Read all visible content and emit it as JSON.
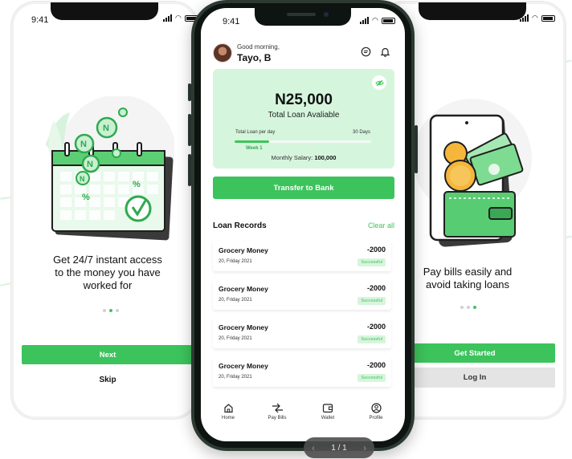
{
  "accent": "#3cc35c",
  "left_screen": {
    "time": "9:41",
    "onboarding_text": "Get 24/7 instant access to the money you have worked for",
    "next_label": "Next",
    "skip_label": "Skip",
    "active_dot": 2
  },
  "right_screen": {
    "onboarding_text": "Pay bills easily and avoid taking loans",
    "get_started_label": "Get Started",
    "login_label": "Log In",
    "active_dot": 3
  },
  "center_screen": {
    "time": "9:41",
    "greeting": "Good morning,",
    "username": "Tayo, B",
    "balance": {
      "amount": "N25,000",
      "label": "Total Loan Avaliable",
      "period_left": "Total Loan per day",
      "period_right": "30 Days",
      "progress": 0.25,
      "week_label": "Week 1",
      "salary_label": "Monthly Salary:",
      "salary_value": "100,000"
    },
    "transfer_label": "Transfer to Bank",
    "records_title": "Loan Records",
    "clear_all": "Clear all",
    "records": [
      {
        "name": "Grocery Money",
        "date": "20, Friday 2021",
        "amount": "-2000",
        "status": "Successful"
      },
      {
        "name": "Grocery Money",
        "date": "20, Friday 2021",
        "amount": "-2000",
        "status": "Successful"
      },
      {
        "name": "Grocery Money",
        "date": "20, Friday 2021",
        "amount": "-2000",
        "status": "Successful"
      },
      {
        "name": "Grocery Money",
        "date": "20, Friday 2021",
        "amount": "-2000",
        "status": "Successful"
      }
    ],
    "tabs": [
      {
        "label": "Home",
        "icon": "home-icon"
      },
      {
        "label": "Pay Bills",
        "icon": "transfer-arrows-icon"
      },
      {
        "label": "Wallet",
        "icon": "wallet-icon"
      },
      {
        "label": "Profile",
        "icon": "profile-icon"
      }
    ]
  },
  "pager": {
    "label": "1 / 1"
  }
}
